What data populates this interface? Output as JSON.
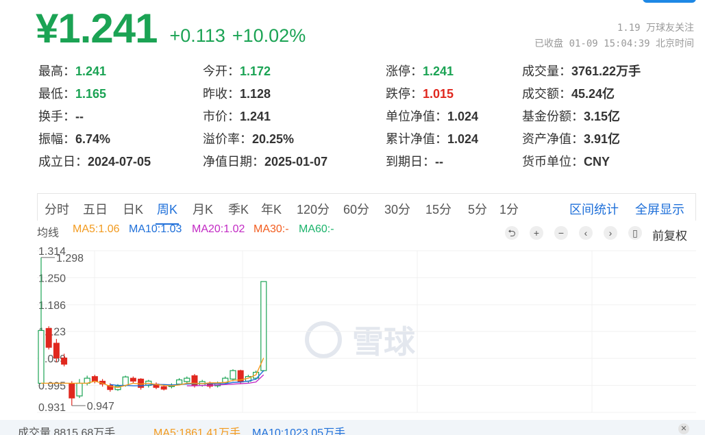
{
  "quote": {
    "price": "¥1.241",
    "change": "+0.113",
    "change_pct": "+10.02%",
    "followers": "1.19 万球友关注",
    "status_time": "已收盘 01-09 15:04:39 北京时间"
  },
  "stats": [
    {
      "label": "最高：",
      "value": "1.241",
      "tone": "green"
    },
    {
      "label": "今开：",
      "value": "1.172",
      "tone": "green"
    },
    {
      "label": "涨停：",
      "value": "1.241",
      "tone": "green"
    },
    {
      "label": "成交量：",
      "value": "3761.22万手",
      "tone": "plain"
    },
    {
      "label": "最低：",
      "value": "1.165",
      "tone": "green"
    },
    {
      "label": "昨收：",
      "value": "1.128",
      "tone": "plain"
    },
    {
      "label": "跌停：",
      "value": "1.015",
      "tone": "red"
    },
    {
      "label": "成交额：",
      "value": "45.24亿",
      "tone": "plain"
    },
    {
      "label": "换手：",
      "value": "--",
      "tone": "plain"
    },
    {
      "label": "市价：",
      "value": "1.241",
      "tone": "plain"
    },
    {
      "label": "单位净值：",
      "value": "1.024",
      "tone": "plain"
    },
    {
      "label": "基金份额：",
      "value": "3.15亿",
      "tone": "plain"
    },
    {
      "label": "振幅：",
      "value": "6.74%",
      "tone": "plain"
    },
    {
      "label": "溢价率：",
      "value": "20.25%",
      "tone": "plain"
    },
    {
      "label": "累计净值：",
      "value": "1.024",
      "tone": "plain"
    },
    {
      "label": "资产净值：",
      "value": "3.91亿",
      "tone": "plain"
    },
    {
      "label": "成立日：",
      "value": "2024-07-05",
      "tone": "plain"
    },
    {
      "label": "净值日期：",
      "value": "2025-01-07",
      "tone": "plain"
    },
    {
      "label": "到期日：",
      "value": "--",
      "tone": "plain"
    },
    {
      "label": "货币单位：",
      "value": "CNY",
      "tone": "plain"
    }
  ],
  "tabs": [
    "分时",
    "五日",
    "日K",
    "周K",
    "月K",
    "季K",
    "年K",
    "120分",
    "60分",
    "30分",
    "15分",
    "5分",
    "1分"
  ],
  "active_tab": "周K",
  "tab_links": [
    "区间统计",
    "全屏显示"
  ],
  "indicators": {
    "line_label": "均线",
    "ma5": "MA5:1.06",
    "ma10": "MA10:1.03",
    "ma20": "MA20:1.02",
    "ma30": "MA30:-",
    "ma60": "MA60:-",
    "colors": {
      "ma5": "#f29a1e",
      "ma10": "#1e6fd9",
      "ma20": "#c229c4",
      "ma30": "#f25c1e",
      "ma60": "#1bb36b"
    }
  },
  "toolbar": {
    "icons": [
      "undo-icon",
      "zoom-in-icon",
      "zoom-out-icon",
      "prev-icon",
      "next-icon",
      "candle-toggle-icon"
    ],
    "glyphs": [
      "⮌",
      "+",
      "−",
      "‹",
      "›",
      "▯"
    ],
    "adjust": "前复权"
  },
  "watermark": "雪球",
  "volume": {
    "label": "成交量",
    "value": "8815.68万手",
    "ma5": "MA5:1861.41万手",
    "ma10": "MA10:1023.05万手"
  },
  "colors": {
    "up": "#1ba354",
    "down": "#e0281f",
    "accent": "#1e6fd9"
  },
  "chart_data": {
    "type": "candlestick",
    "y_ticks": [
      "1.314",
      "1.250",
      "1.186",
      "1.123",
      "1.059",
      "0.995",
      "0.931"
    ],
    "ylim": [
      0.931,
      1.314
    ],
    "high_marker": "1.298",
    "low_marker": "0.947",
    "candles": [
      {
        "o": 1.0,
        "c": 1.125,
        "h": 1.298,
        "l": 1.0
      },
      {
        "o": 1.13,
        "c": 1.085,
        "h": 1.135,
        "l": 1.08
      },
      {
        "o": 1.095,
        "c": 1.06,
        "h": 1.105,
        "l": 1.05
      },
      {
        "o": 1.06,
        "c": 1.045,
        "h": 1.07,
        "l": 1.04
      },
      {
        "o": 1.0,
        "c": 0.965,
        "h": 1.005,
        "l": 0.947
      },
      {
        "o": 0.97,
        "c": 1.0,
        "h": 1.01,
        "l": 0.965
      },
      {
        "o": 1.0,
        "c": 1.012,
        "h": 1.018,
        "l": 0.995
      },
      {
        "o": 1.016,
        "c": 1.005,
        "h": 1.02,
        "l": 1.0
      },
      {
        "o": 1.005,
        "c": 0.998,
        "h": 1.01,
        "l": 0.992
      },
      {
        "o": 0.995,
        "c": 0.985,
        "h": 1.0,
        "l": 0.98
      },
      {
        "o": 0.985,
        "c": 0.993,
        "h": 0.998,
        "l": 0.982
      },
      {
        "o": 0.995,
        "c": 1.015,
        "h": 1.018,
        "l": 0.992
      },
      {
        "o": 1.012,
        "c": 1.005,
        "h": 1.016,
        "l": 1.0
      },
      {
        "o": 1.01,
        "c": 0.99,
        "h": 1.012,
        "l": 0.985
      },
      {
        "o": 0.995,
        "c": 1.005,
        "h": 1.008,
        "l": 0.99
      },
      {
        "o": 0.998,
        "c": 0.99,
        "h": 1.002,
        "l": 0.986
      },
      {
        "o": 0.992,
        "c": 0.986,
        "h": 0.996,
        "l": 0.983
      },
      {
        "o": 0.992,
        "c": 0.996,
        "h": 1.0,
        "l": 0.988
      },
      {
        "o": 0.998,
        "c": 1.008,
        "h": 1.012,
        "l": 0.995
      },
      {
        "o": 1.004,
        "c": 1.012,
        "h": 1.016,
        "l": 1.0
      },
      {
        "o": 1.018,
        "c": 0.996,
        "h": 1.022,
        "l": 0.99
      },
      {
        "o": 0.995,
        "c": 1.004,
        "h": 1.008,
        "l": 0.992
      },
      {
        "o": 1.0,
        "c": 0.993,
        "h": 1.004,
        "l": 0.988
      },
      {
        "o": 0.994,
        "c": 1.0,
        "h": 1.004,
        "l": 0.99
      },
      {
        "o": 1.002,
        "c": 1.012,
        "h": 1.016,
        "l": 0.998
      },
      {
        "o": 1.01,
        "c": 1.03,
        "h": 1.033,
        "l": 1.005
      },
      {
        "o": 1.03,
        "c": 1.003,
        "h": 1.032,
        "l": 0.998
      },
      {
        "o": 1.005,
        "c": 1.016,
        "h": 1.02,
        "l": 1.0
      },
      {
        "o": 1.012,
        "c": 1.026,
        "h": 1.03,
        "l": 1.008
      },
      {
        "o": 1.03,
        "c": 1.241,
        "h": 1.241,
        "l": 1.028
      }
    ],
    "ma5": [
      1.0,
      1.0,
      1.0,
      1.0,
      1.0,
      1.0,
      1.0,
      1.005,
      1.0,
      0.993,
      0.99,
      0.995,
      1.0,
      0.998,
      1.0,
      0.997,
      0.995,
      0.994,
      0.996,
      1.0,
      1.0,
      0.999,
      1.001,
      1.001,
      1.002,
      1.007,
      1.008,
      1.012,
      1.02,
      1.06
    ],
    "ma10": [
      null,
      null,
      null,
      null,
      null,
      null,
      null,
      null,
      null,
      0.997,
      0.995,
      0.995,
      0.994,
      0.994,
      0.996,
      0.997,
      0.997,
      0.996,
      0.997,
      0.998,
      0.999,
      0.999,
      0.999,
      0.999,
      0.999,
      1.002,
      1.003,
      1.005,
      1.01,
      1.03
    ],
    "ma20": [
      null,
      null,
      null,
      null,
      null,
      null,
      null,
      null,
      null,
      null,
      null,
      null,
      null,
      null,
      null,
      null,
      null,
      null,
      null,
      0.994,
      0.994,
      0.995,
      0.995,
      0.996,
      0.997,
      0.998,
      0.999,
      1.0,
      1.003,
      1.02
    ]
  }
}
